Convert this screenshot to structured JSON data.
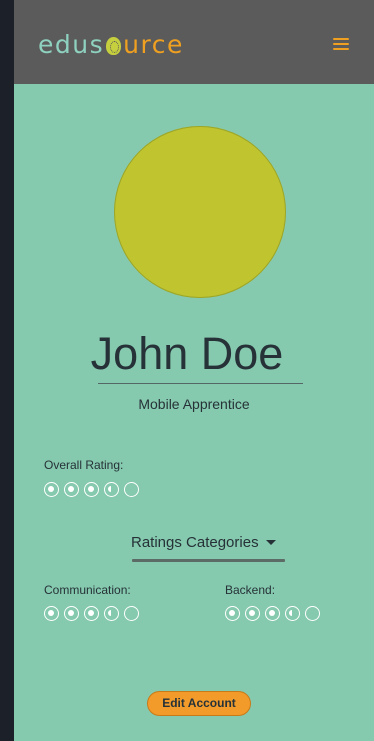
{
  "header": {
    "logo_prefix": "edus",
    "logo_suffix": "urce",
    "menu_icon": "hamburger-icon",
    "colors": {
      "bar": "#5b5b5b",
      "logo_primary": "#8fd1bf",
      "accent": "#f0a020"
    }
  },
  "profile": {
    "name": "John Doe",
    "role": "Mobile Apprentice",
    "avatar_color": "#c0c42f"
  },
  "overall": {
    "label": "Overall Rating:",
    "rating": 3.5,
    "max": 5
  },
  "categories": {
    "label": "Ratings Categories",
    "items": [
      {
        "label": "Communication:",
        "rating": 3.5,
        "max": 5
      },
      {
        "label": "Backend:",
        "rating": 3.5,
        "max": 5
      }
    ]
  },
  "actions": {
    "edit_label": "Edit Account"
  },
  "theme": {
    "page_bg": "#85c9ae",
    "outer_bg": "#1c2028",
    "text": "#263238",
    "button_bg": "#f29b2b"
  }
}
